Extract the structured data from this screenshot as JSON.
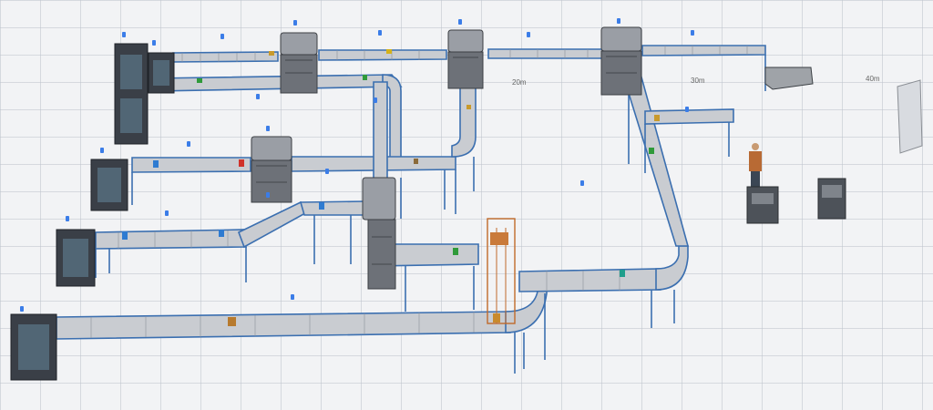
{
  "colors": {
    "accent": "#3b7de8",
    "frame": "#3b6fb0",
    "roller": "#c9ccd1",
    "floor": "#f2f3f5"
  },
  "distance_markers": [
    "20m",
    "30m",
    "40m"
  ],
  "icons": {
    "boxes": "package-icon",
    "operator": "worker-icon",
    "lift": "vertical-lift-icon"
  }
}
